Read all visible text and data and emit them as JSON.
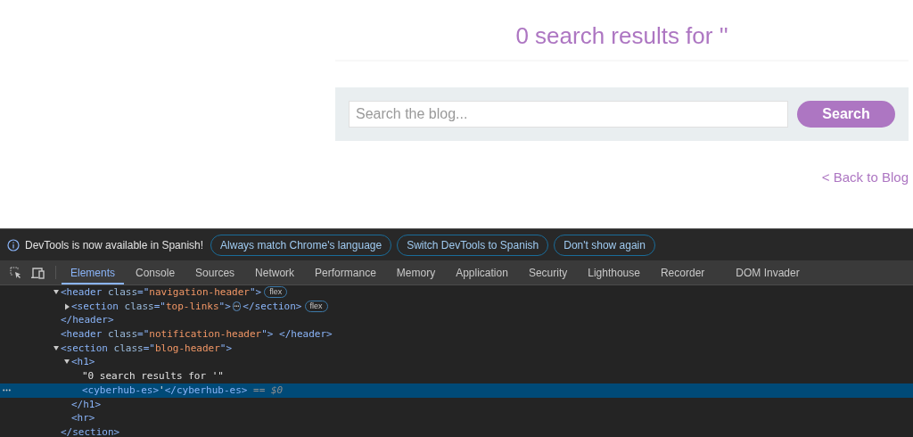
{
  "page": {
    "heading": "0 search results for ''",
    "search": {
      "placeholder": "Search the blog...",
      "button": "Search"
    },
    "back_link": "< Back to Blog"
  },
  "devtools": {
    "infobar": {
      "message": "DevTools is now available in Spanish!",
      "buttons": [
        "Always match Chrome's language",
        "Switch DevTools to Spanish",
        "Don't show again"
      ]
    },
    "tabs": [
      {
        "label": "Elements",
        "selected": true
      },
      {
        "label": "Console",
        "selected": false
      },
      {
        "label": "Sources",
        "selected": false
      },
      {
        "label": "Network",
        "selected": false
      },
      {
        "label": "Performance",
        "selected": false
      },
      {
        "label": "Memory",
        "selected": false
      },
      {
        "label": "Application",
        "selected": false
      },
      {
        "label": "Security",
        "selected": false
      },
      {
        "label": "Lighthouse",
        "selected": false
      },
      {
        "label": "Recorder",
        "selected": false
      },
      {
        "label": "DOM Invader",
        "selected": false
      }
    ],
    "dom_tree": [
      {
        "expanded": true,
        "selected": false,
        "tokens": [
          {
            "kind": "tag",
            "text": "<header"
          },
          {
            "kind": "attr",
            "text": " class"
          },
          {
            "kind": "tag",
            "text": "=\""
          },
          {
            "kind": "value",
            "text": "navigation-header"
          },
          {
            "kind": "tag",
            "text": "\">"
          }
        ],
        "badges": [
          "flex"
        ],
        "children": [
          {
            "expanded": false,
            "selected": false,
            "tokens": [
              {
                "kind": "tag",
                "text": "<section"
              },
              {
                "kind": "attr",
                "text": " class"
              },
              {
                "kind": "tag",
                "text": "=\""
              },
              {
                "kind": "value",
                "text": "top-links"
              },
              {
                "kind": "tag",
                "text": "\">"
              },
              {
                "kind": "ellipsis",
                "text": "⋯"
              },
              {
                "kind": "tag",
                "text": "</section>"
              }
            ],
            "badges": [
              "flex"
            ]
          }
        ]
      },
      {
        "selected": false,
        "tokens": [
          {
            "kind": "tag",
            "text": "</header>"
          }
        ]
      },
      {
        "selected": false,
        "tokens": [
          {
            "kind": "tag",
            "text": "<header"
          },
          {
            "kind": "attr",
            "text": " class"
          },
          {
            "kind": "tag",
            "text": "=\""
          },
          {
            "kind": "value",
            "text": "notification-header"
          },
          {
            "kind": "tag",
            "text": "\"> </header>"
          }
        ]
      },
      {
        "expanded": true,
        "selected": false,
        "tokens": [
          {
            "kind": "tag",
            "text": "<section"
          },
          {
            "kind": "attr",
            "text": " class"
          },
          {
            "kind": "tag",
            "text": "=\""
          },
          {
            "kind": "value",
            "text": "blog-header"
          },
          {
            "kind": "tag",
            "text": "\">"
          }
        ],
        "children": [
          {
            "expanded": true,
            "selected": false,
            "tokens": [
              {
                "kind": "tag",
                "text": "<h1>"
              }
            ],
            "children": [
              {
                "selected": false,
                "tokens": [
                  {
                    "kind": "text",
                    "text": "\"0 search results for '\""
                  }
                ]
              },
              {
                "selected": true,
                "tokens": [
                  {
                    "kind": "tag",
                    "text": "<cyberhub-es>"
                  },
                  {
                    "kind": "text",
                    "text": "'"
                  },
                  {
                    "kind": "tag",
                    "text": "</cyberhub-es>"
                  },
                  {
                    "kind": "ref",
                    "text": " == $0"
                  }
                ]
              }
            ]
          },
          {
            "selected": false,
            "tokens": [
              {
                "kind": "tag",
                "text": "</h1>"
              }
            ]
          },
          {
            "selected": false,
            "tokens": [
              {
                "kind": "tag",
                "text": "<hr>"
              }
            ]
          }
        ]
      },
      {
        "selected": false,
        "tokens": [
          {
            "kind": "tag",
            "text": "</section>"
          }
        ]
      }
    ]
  }
}
